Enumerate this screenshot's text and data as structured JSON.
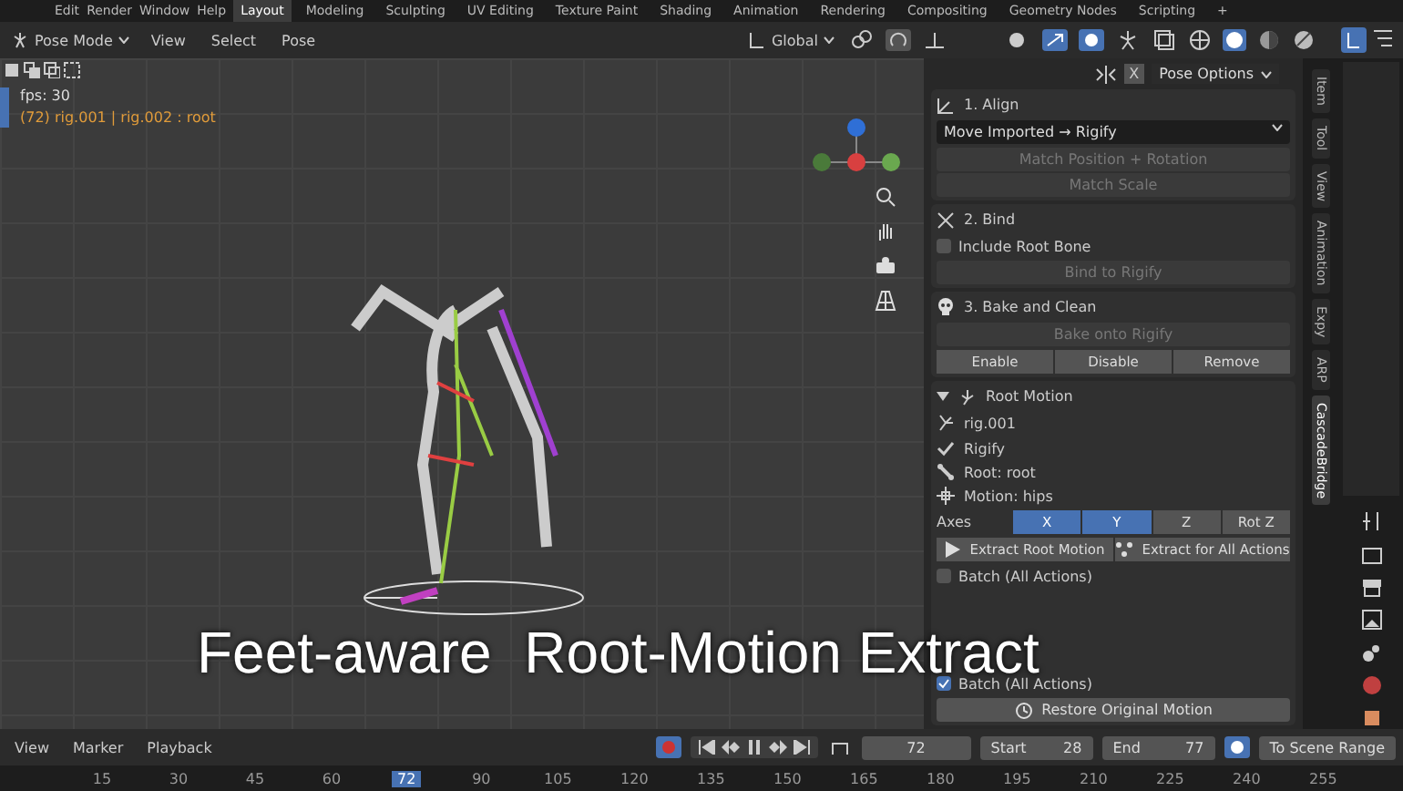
{
  "top_menu": {
    "items": [
      "Edit",
      "Render",
      "Window",
      "Help"
    ],
    "workspaces": [
      {
        "label": "Layout",
        "selected": true
      },
      {
        "label": "Modeling",
        "selected": false
      },
      {
        "label": "Sculpting",
        "selected": false
      },
      {
        "label": "UV Editing",
        "selected": false
      },
      {
        "label": "Texture Paint",
        "selected": false
      },
      {
        "label": "Shading",
        "selected": false
      },
      {
        "label": "Animation",
        "selected": false
      },
      {
        "label": "Rendering",
        "selected": false
      },
      {
        "label": "Compositing",
        "selected": false
      },
      {
        "label": "Geometry Nodes",
        "selected": false
      },
      {
        "label": "Scripting",
        "selected": false
      }
    ],
    "add_tab": "+"
  },
  "header": {
    "mode": "Pose Mode",
    "menus": [
      "View",
      "Select",
      "Pose"
    ],
    "orientation": "Global",
    "options": "Pose Options",
    "mirror": "X"
  },
  "viewport": {
    "fps": "fps: 30",
    "object_info": "(72) rig.001 | rig.002 : root"
  },
  "panel": {
    "align": {
      "title": "1. Align",
      "dropdown": "Move Imported → Rigify",
      "buttons": [
        {
          "label": "Match Position + Rotation",
          "disabled": true
        },
        {
          "label": "Match Scale",
          "disabled": true
        }
      ]
    },
    "bind": {
      "title": "2. Bind",
      "checkbox": {
        "label": "Include Root Bone",
        "checked": false
      },
      "button": {
        "label": "Bind to Rigify",
        "disabled": true
      }
    },
    "bake": {
      "title": "3. Bake and Clean",
      "button": {
        "label": "Bake onto Rigify",
        "disabled": true
      },
      "segments": [
        "Enable",
        "Disable",
        "Remove"
      ]
    },
    "root_motion": {
      "title": "Root Motion",
      "expanded": true,
      "object": "rig.001",
      "info": [
        {
          "kind": "check",
          "label": "Rigify"
        },
        {
          "kind": "bone",
          "label": "Root: root"
        },
        {
          "kind": "move",
          "label": "Motion: hips"
        }
      ],
      "axes_label": "Axes",
      "axes": [
        {
          "label": "X",
          "selected": true
        },
        {
          "label": "Y",
          "selected": true
        },
        {
          "label": "Z",
          "selected": false
        },
        {
          "label": "Rot Z",
          "selected": false
        }
      ],
      "actions": [
        {
          "kind": "play",
          "label": "Extract Root Motion"
        },
        {
          "kind": "multi",
          "label": "Extract for All Actions"
        }
      ],
      "batch_top": {
        "label": "Batch (All Actions)",
        "checked": false
      },
      "batch_bottom": {
        "label": "Batch (All Actions)",
        "checked": true
      },
      "restore": "Restore Original Motion"
    }
  },
  "side_tabs": [
    {
      "label": "Item",
      "selected": false
    },
    {
      "label": "Tool",
      "selected": false
    },
    {
      "label": "View",
      "selected": false
    },
    {
      "label": "Animation",
      "selected": false
    },
    {
      "label": "Expy",
      "selected": false
    },
    {
      "label": "ARP",
      "selected": false
    },
    {
      "label": "CascadeBridge",
      "selected": true
    }
  ],
  "timeline": {
    "menus": [
      "View",
      "Marker",
      "Playback"
    ],
    "current": "72",
    "start_label": "Start",
    "start": "28",
    "end_label": "End",
    "end": "77",
    "range_button": "To Scene Range",
    "ticks": [
      {
        "label": "15",
        "selected": false
      },
      {
        "label": "30",
        "selected": false
      },
      {
        "label": "45",
        "selected": false
      },
      {
        "label": "60",
        "selected": false
      },
      {
        "label": "72",
        "selected": true
      },
      {
        "label": "90",
        "selected": false
      },
      {
        "label": "105",
        "selected": false
      },
      {
        "label": "120",
        "selected": false
      },
      {
        "label": "135",
        "selected": false
      },
      {
        "label": "150",
        "selected": false
      },
      {
        "label": "165",
        "selected": false
      },
      {
        "label": "180",
        "selected": false
      },
      {
        "label": "195",
        "selected": false
      },
      {
        "label": "210",
        "selected": false
      },
      {
        "label": "225",
        "selected": false
      },
      {
        "label": "240",
        "selected": false
      },
      {
        "label": "255",
        "selected": false
      }
    ]
  },
  "caption": "Feet-aware  Root-Motion Extract"
}
